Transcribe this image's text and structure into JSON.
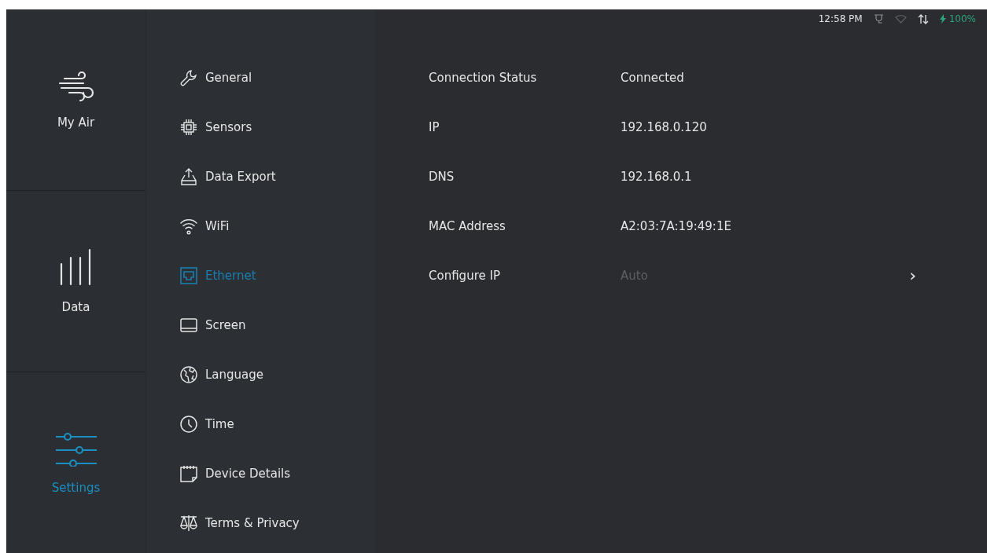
{
  "status_bar": {
    "time": "12:58 PM",
    "battery": "100%",
    "charging": true
  },
  "nav": [
    {
      "label": "My Air",
      "kind": "wind",
      "selected": false
    },
    {
      "label": "Data",
      "kind": "bars",
      "selected": false
    },
    {
      "label": "Settings",
      "kind": "sliders",
      "selected": true
    }
  ],
  "menu": [
    {
      "label": "General",
      "kind": "wrench",
      "selected": false
    },
    {
      "label": "Sensors",
      "kind": "chip",
      "selected": false
    },
    {
      "label": "Data Export",
      "kind": "export",
      "selected": false
    },
    {
      "label": "WiFi",
      "kind": "wifi",
      "selected": false
    },
    {
      "label": "Ethernet",
      "kind": "ethernet",
      "selected": true
    },
    {
      "label": "Screen",
      "kind": "screen",
      "selected": false
    },
    {
      "label": "Language",
      "kind": "globe",
      "selected": false
    },
    {
      "label": "Time",
      "kind": "clock",
      "selected": false
    },
    {
      "label": "Device Details",
      "kind": "note",
      "selected": false
    },
    {
      "label": "Terms & Privacy",
      "kind": "scale",
      "selected": false
    }
  ],
  "details": [
    {
      "label": "Connection Status",
      "value": "Connected",
      "disabled": false
    },
    {
      "label": "IP",
      "value": "192.168.0.120",
      "disabled": false
    },
    {
      "label": "DNS",
      "value": "192.168.0.1",
      "disabled": false
    },
    {
      "label": "MAC Address",
      "value": "A2:03:7A:19:49:1E",
      "disabled": false
    }
  ],
  "configure": {
    "label": "Configure IP",
    "value": "Auto",
    "disabled": true,
    "chevron": "›"
  }
}
